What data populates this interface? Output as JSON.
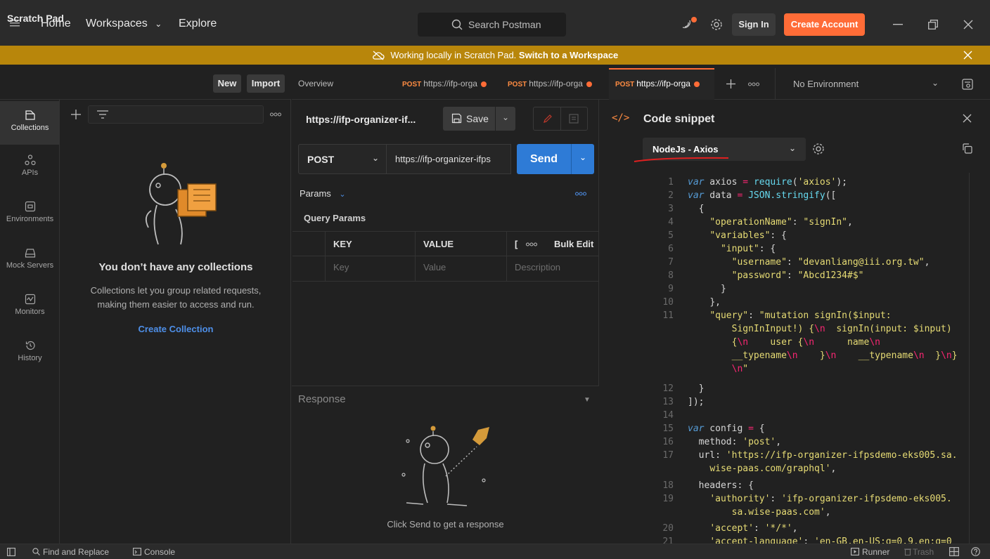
{
  "topbar": {
    "nav": {
      "home": "Home",
      "workspaces": "Workspaces",
      "explore": "Explore"
    },
    "search_placeholder": "Search Postman",
    "sign_in": "Sign In",
    "create_account": "Create Account"
  },
  "banner": {
    "text": "Working locally in Scratch Pad.",
    "link": "Switch to a Workspace"
  },
  "scratchpad": {
    "title": "Scratch Pad",
    "new_label": "New",
    "import_label": "Import"
  },
  "sidebar": {
    "items": [
      {
        "label": "Collections",
        "icon": "collections-icon",
        "active": true
      },
      {
        "label": "APIs",
        "icon": "apis-icon",
        "active": false
      },
      {
        "label": "Environments",
        "icon": "environments-icon",
        "active": false
      },
      {
        "label": "Mock Servers",
        "icon": "mock-servers-icon",
        "active": false
      },
      {
        "label": "Monitors",
        "icon": "monitors-icon",
        "active": false
      },
      {
        "label": "History",
        "icon": "history-icon",
        "active": false
      }
    ]
  },
  "collections": {
    "empty_title": "You don’t have any collections",
    "empty_desc": "Collections let you group related requests, making them easier to access and run.",
    "create_label": "Create Collection"
  },
  "tabs": {
    "overview": "Overview",
    "items": [
      {
        "method": "POST",
        "url": "https://ifp-orga"
      },
      {
        "method": "POST",
        "url": "https://ifp-orga"
      },
      {
        "method": "POST",
        "url": "https://ifp-orga"
      }
    ],
    "environment": "No Environment"
  },
  "request": {
    "name": "https://ifp-organizer-if...",
    "save_label": "Save",
    "method": "POST",
    "url": "https://ifp-organizer-ifps",
    "send_label": "Send",
    "params_tab": "Params",
    "query_params_title": "Query Params",
    "table": {
      "headers": {
        "key": "KEY",
        "value": "VALUE",
        "desc": "[",
        "bulk_edit": "Bulk Edit"
      },
      "placeholders": {
        "key": "Key",
        "value": "Value",
        "desc": "Description"
      }
    }
  },
  "response": {
    "title": "Response",
    "hint": "Click Send to get a response"
  },
  "code_snippet": {
    "title": "Code snippet",
    "language": "NodeJs - Axios",
    "line_numbers": [
      "1",
      "2",
      "3",
      "4",
      "5",
      "6",
      "7",
      "8",
      "9",
      "10",
      "11",
      "12",
      "13",
      "14",
      "15",
      "16",
      "17",
      "18",
      "19",
      "20",
      "21"
    ]
  },
  "statusbar": {
    "find_replace": "Find and Replace",
    "console": "Console",
    "runner": "Runner",
    "trash": "Trash"
  },
  "colors": {
    "accent": "#ff6c37",
    "banner": "#b8860b",
    "send": "#2e7bd6",
    "link": "#4e8fe8"
  }
}
